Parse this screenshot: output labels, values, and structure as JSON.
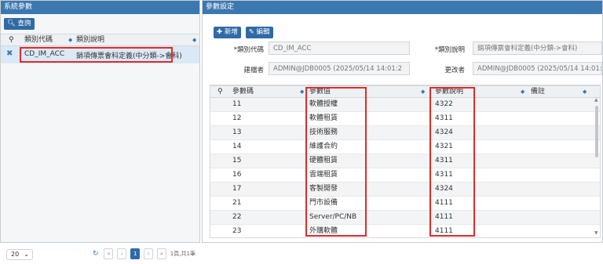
{
  "left_panel": {
    "title": "系統參數",
    "query_button": "查詢",
    "columns": [
      "類別代碼",
      "類別說明"
    ],
    "rows": [
      {
        "code": "CD_IM_ACC",
        "desc": "銷項傳票會科定義(中分類->會科)"
      }
    ],
    "page_size": "20",
    "pager": {
      "current_page": "1",
      "summary": "1頁,共1筆"
    }
  },
  "right_panel": {
    "title": "參數設定",
    "buttons": {
      "add": "新增",
      "edit": "編輯"
    },
    "form": {
      "category_code_label": "*類別代碼",
      "category_code_value": "CD_IM_ACC",
      "category_desc_label": "*類別說明",
      "category_desc_value": "銷項傳票會科定義(中分類->會科)",
      "creator_label": "建檔者",
      "creator_value": "ADMIN@JDB0005 (2025/05/14 14:01:2",
      "modifier_label": "更改者",
      "modifier_value": "ADMIN@JDB0005 (2025/05/14 14:01:2"
    },
    "columns": [
      "參數碼",
      "參數值",
      "參數說明",
      "備註"
    ],
    "rows": [
      {
        "code": "11",
        "value": "軟體授權",
        "desc": "4322",
        "note": ""
      },
      {
        "code": "12",
        "value": "軟體租賃",
        "desc": "4311",
        "note": ""
      },
      {
        "code": "13",
        "value": "技術服務",
        "desc": "4324",
        "note": ""
      },
      {
        "code": "14",
        "value": "維護合約",
        "desc": "4321",
        "note": ""
      },
      {
        "code": "15",
        "value": "硬體租賃",
        "desc": "4311",
        "note": ""
      },
      {
        "code": "16",
        "value": "雲端租賃",
        "desc": "4311",
        "note": ""
      },
      {
        "code": "17",
        "value": "客製開發",
        "desc": "4324",
        "note": ""
      },
      {
        "code": "21",
        "value": "門市設備",
        "desc": "4111",
        "note": ""
      },
      {
        "code": "22",
        "value": "Server/PC/NB",
        "desc": "4111",
        "note": ""
      },
      {
        "code": "23",
        "value": "外購軟體",
        "desc": "4111",
        "note": ""
      }
    ]
  },
  "colors": {
    "header_blue": "#3c78b0",
    "button_blue": "#2f6aa6",
    "highlight_red": "#e02b2b",
    "selected_row": "#dbe8f5"
  }
}
